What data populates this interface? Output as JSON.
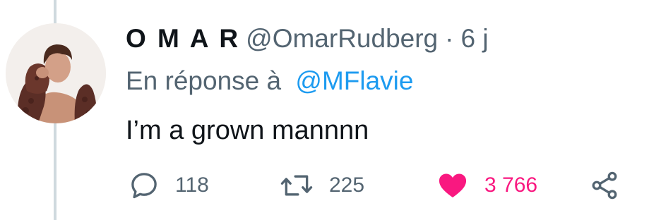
{
  "tweet": {
    "display_name": "O M A R",
    "handle": "@OmarRudberg",
    "separator": "·",
    "time": "6 j",
    "reply_prefix": "En réponse à",
    "reply_to": "@MFlavie",
    "text": "I’m a grown mannnn"
  },
  "actions": {
    "reply": {
      "icon": "speech-bubble-icon",
      "count": "118"
    },
    "retweet": {
      "icon": "retweet-icon",
      "count": "225"
    },
    "like": {
      "icon": "heart-icon",
      "count": "3 766",
      "active": true
    },
    "share": {
      "icon": "share-icon"
    }
  },
  "colors": {
    "primary_text": "#0f1419",
    "secondary_text": "#536471",
    "link": "#1d9bf0",
    "like": "#f91880",
    "thread_line": "#cfd9de"
  }
}
